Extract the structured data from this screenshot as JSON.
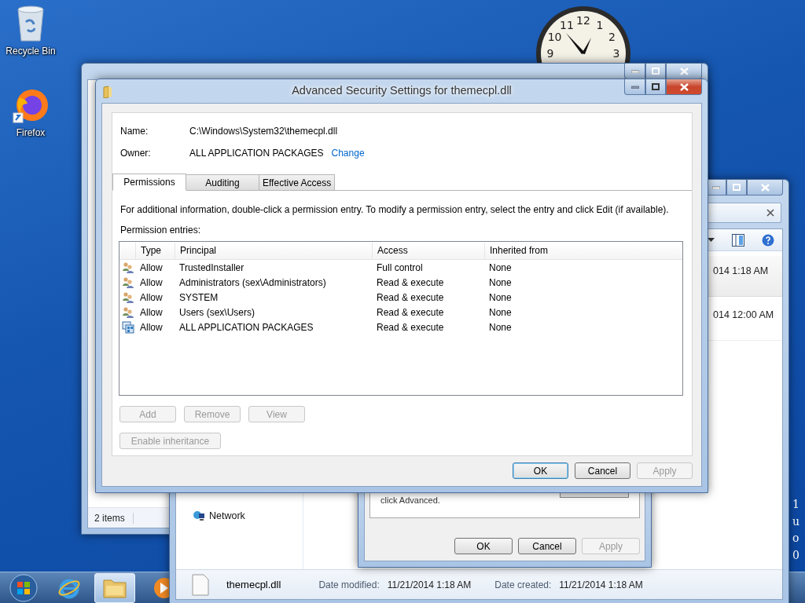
{
  "desktop_icons": [
    {
      "label": "Recycle Bin",
      "kind": "bin"
    },
    {
      "label": "Firefox",
      "kind": "browser"
    }
  ],
  "clock": {
    "numerals": [
      "12",
      "1",
      "2",
      "3",
      "9",
      "10",
      "11"
    ]
  },
  "taskbar": {
    "items": [
      {
        "kind": "start",
        "selected": false
      },
      {
        "kind": "ie",
        "selected": false
      },
      {
        "kind": "explorer",
        "selected": true
      },
      {
        "kind": "media",
        "selected": false
      }
    ]
  },
  "back_explorer": {
    "status": "2 items"
  },
  "right_explorer": {
    "rows": [
      {
        "text": "014 1:18 AM",
        "selected": true
      },
      {
        "text": "014 12:00 AM",
        "selected": false
      }
    ],
    "nav_item": "Network",
    "details": {
      "file": "themecpl.dll",
      "modified_label": "Date modified:",
      "modified": "11/21/2014 1:18 AM",
      "created_label": "Date created:",
      "created": "11/21/2014 1:18 AM"
    }
  },
  "properties_dialog": {
    "text": "click Advanced.",
    "buttons": [
      {
        "label": "OK",
        "disabled": false
      },
      {
        "label": "Cancel",
        "disabled": false
      },
      {
        "label": "Apply",
        "disabled": true
      }
    ]
  },
  "edge_text": "1uo0",
  "dialog": {
    "title": "Advanced Security Settings for themecpl.dll",
    "name_label": "Name:",
    "name": "C:\\Windows\\System32\\themecpl.dll",
    "owner_label": "Owner:",
    "owner": "ALL APPLICATION PACKAGES",
    "change_link": "Change",
    "tabs": [
      {
        "label": "Permissions",
        "selected": true
      },
      {
        "label": "Auditing",
        "selected": false
      },
      {
        "label": "Effective Access",
        "selected": false
      }
    ],
    "instructions": "For additional information, double-click a permission entry. To modify a permission entry, select the entry and click Edit (if available).",
    "entries_label": "Permission entries:",
    "columns": [
      "Type",
      "Principal",
      "Access",
      "Inherited from"
    ],
    "entries": [
      {
        "kind": "group",
        "type": "Allow",
        "principal": "TrustedInstaller",
        "access": "Full control",
        "inherited_from": "None"
      },
      {
        "kind": "group",
        "type": "Allow",
        "principal": "Administrators (sex\\Administrators)",
        "access": "Read & execute",
        "inherited_from": "None"
      },
      {
        "kind": "group",
        "type": "Allow",
        "principal": "SYSTEM",
        "access": "Read & execute",
        "inherited_from": "None"
      },
      {
        "kind": "group",
        "type": "Allow",
        "principal": "Users (sex\\Users)",
        "access": "Read & execute",
        "inherited_from": "None"
      },
      {
        "kind": "package",
        "type": "Allow",
        "principal": "ALL APPLICATION PACKAGES",
        "access": "Read & execute",
        "inherited_from": "None"
      }
    ],
    "entry_buttons": [
      {
        "label": "Add",
        "disabled": true
      },
      {
        "label": "Remove",
        "disabled": true
      },
      {
        "label": "View",
        "disabled": true
      }
    ],
    "inheritance_button": {
      "label": "Enable inheritance",
      "disabled": true
    },
    "buttons": [
      {
        "label": "OK",
        "disabled": false,
        "default": true
      },
      {
        "label": "Cancel",
        "disabled": false,
        "default": false
      },
      {
        "label": "Apply",
        "disabled": true,
        "default": false
      }
    ]
  }
}
